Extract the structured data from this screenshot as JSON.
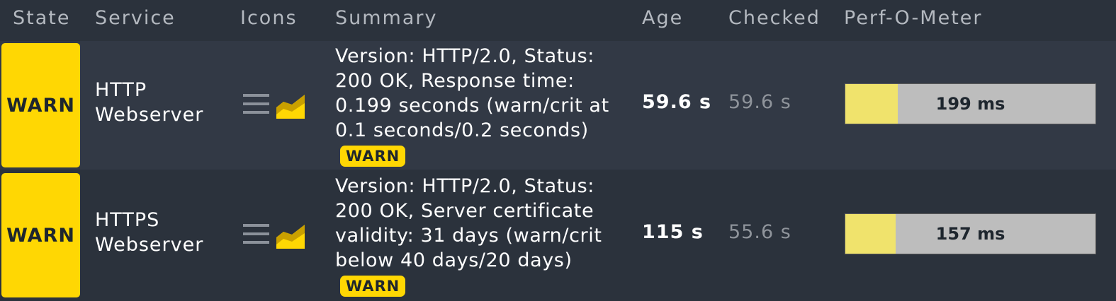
{
  "columns": {
    "state": "State",
    "service": "Service",
    "icons": "Icons",
    "summary": "Summary",
    "age": "Age",
    "checked": "Checked",
    "perf": "Perf-O-Meter"
  },
  "colors": {
    "warn": "#ffd703",
    "perf_fill": "#f0e36c",
    "perf_bg": "#bdbdbd"
  },
  "rows": [
    {
      "state": "WARN",
      "service_line1": "HTTP",
      "service_line2": "Webserver",
      "icons": [
        "menu-icon",
        "graph-icon"
      ],
      "summary": "Version: HTTP/2.0, Status: 200 OK, Response time: 0.199 seconds (warn/crit at 0.1 seconds/0.2 seconds)",
      "summary_badge": "WARN",
      "age": "59.6 s",
      "checked": "59.6 s",
      "perf_label": "199 ms",
      "perf_fraction": 0.21
    },
    {
      "state": "WARN",
      "service_line1": "HTTPS",
      "service_line2": "Webserver",
      "icons": [
        "menu-icon",
        "graph-icon"
      ],
      "summary": "Version: HTTP/2.0, Status: 200 OK, Server certificate validity: 31 days (warn/crit below 40 days/20 days)",
      "summary_badge": "WARN",
      "age": "115 s",
      "checked": "55.6 s",
      "perf_label": "157 ms",
      "perf_fraction": 0.2
    }
  ]
}
